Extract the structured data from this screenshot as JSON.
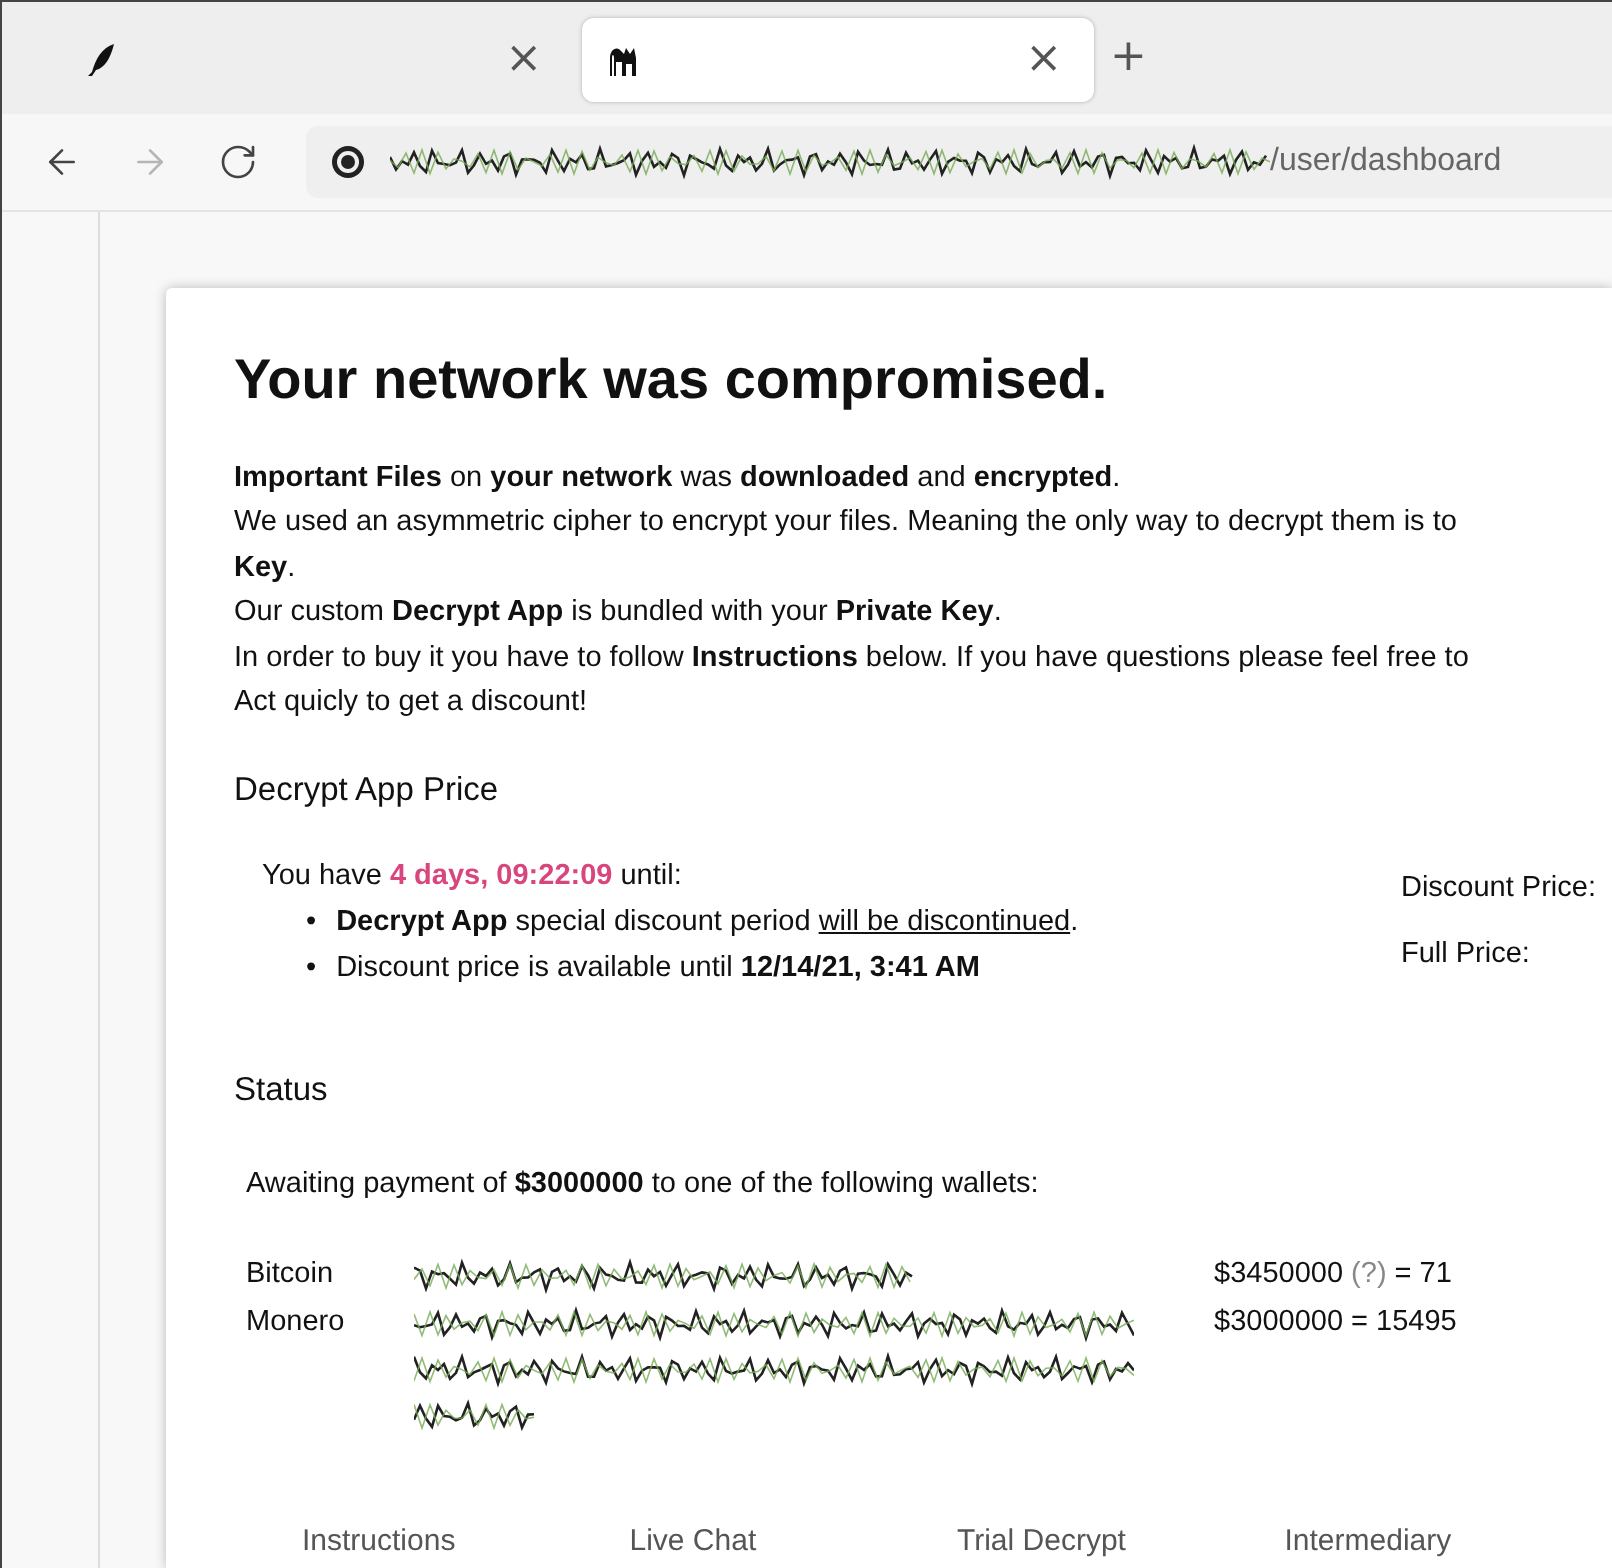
{
  "browser": {
    "tabs": [
      {
        "selected": false,
        "close": "×"
      },
      {
        "selected": true,
        "close": "×"
      }
    ],
    "new_tab": "+",
    "nav": [
      {
        "kind": "back",
        "disabled": false
      },
      {
        "kind": "forward",
        "disabled": true
      },
      {
        "kind": "reload",
        "disabled": false
      }
    ],
    "url": {
      "redacted": true,
      "path": "/user/dashboard"
    }
  },
  "page": {
    "title": "Your network was compromised.",
    "lines": [
      "**Important Files** on **your network** was **downloaded** and **encrypted**.",
      "We used an asymmetric cipher to encrypt your files. Meaning the only way to decrypt them is to",
      "**Key**.",
      "Our custom **Decrypt App** is bundled with your **Private Key**.",
      "In order to buy it you have to follow **Instructions** below. If you have questions please feel free to",
      "Act quicly to get a discount!"
    ],
    "price": {
      "heading": "Decrypt App Price",
      "countdown": {
        "before": "You have ",
        "time": "4 days, 09:22:09",
        "after": " until:"
      },
      "bullets": [
        {
          "marker": "•",
          "parts": [
            {
              "text": "**Decrypt App** special discount period ",
              "underline": false
            },
            {
              "text": "will be discontinued",
              "underline": true
            },
            {
              "text": ".",
              "underline": false
            }
          ]
        },
        {
          "marker": "•",
          "parts": [
            {
              "text": "Discount price is available until **12/14/21, 3:41 AM**",
              "underline": false
            }
          ]
        }
      ],
      "labels": [
        "Discount Price:",
        "Full Price:"
      ]
    },
    "status": {
      "heading": "Status",
      "awaiting": "Awaiting payment of **$3000000** to one of the following wallets:",
      "wallets": [
        {
          "name": "Bitcoin",
          "kind": "short_address",
          "amount": [
            {
              "text": "$3450000 ",
              "muted": false
            },
            {
              "text": "(?)",
              "muted": true
            },
            {
              "text": " = 71",
              "muted": false
            }
          ]
        },
        {
          "name": "Monero",
          "kind": "long_address",
          "amount": [
            {
              "text": "$3000000 = 15495",
              "muted": false
            }
          ]
        }
      ]
    },
    "bottom_tabs": [
      "Instructions",
      "Live Chat",
      "Trial Decrypt",
      "Intermediary"
    ]
  }
}
